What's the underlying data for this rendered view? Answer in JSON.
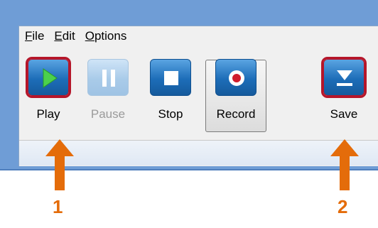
{
  "menu": {
    "file": {
      "key": "F",
      "rest": "ile"
    },
    "edit": {
      "key": "E",
      "rest": "dit"
    },
    "options": {
      "key": "O",
      "rest": "ptions"
    }
  },
  "toolbar": {
    "play": {
      "label": "Play",
      "icon": "play-icon"
    },
    "pause": {
      "label": "Pause",
      "icon": "pause-icon",
      "disabled": true
    },
    "stop": {
      "label": "Stop",
      "icon": "stop-icon"
    },
    "record": {
      "label": "Record",
      "icon": "record-icon"
    },
    "save": {
      "label": "Save",
      "icon": "save-icon"
    }
  },
  "callouts": {
    "one": "1",
    "two": "2"
  },
  "colors": {
    "button_blue": "#1d6db8",
    "highlight_red": "#b5162a",
    "arrow_orange": "#e46c0a",
    "play_green": "#4cd04c"
  }
}
